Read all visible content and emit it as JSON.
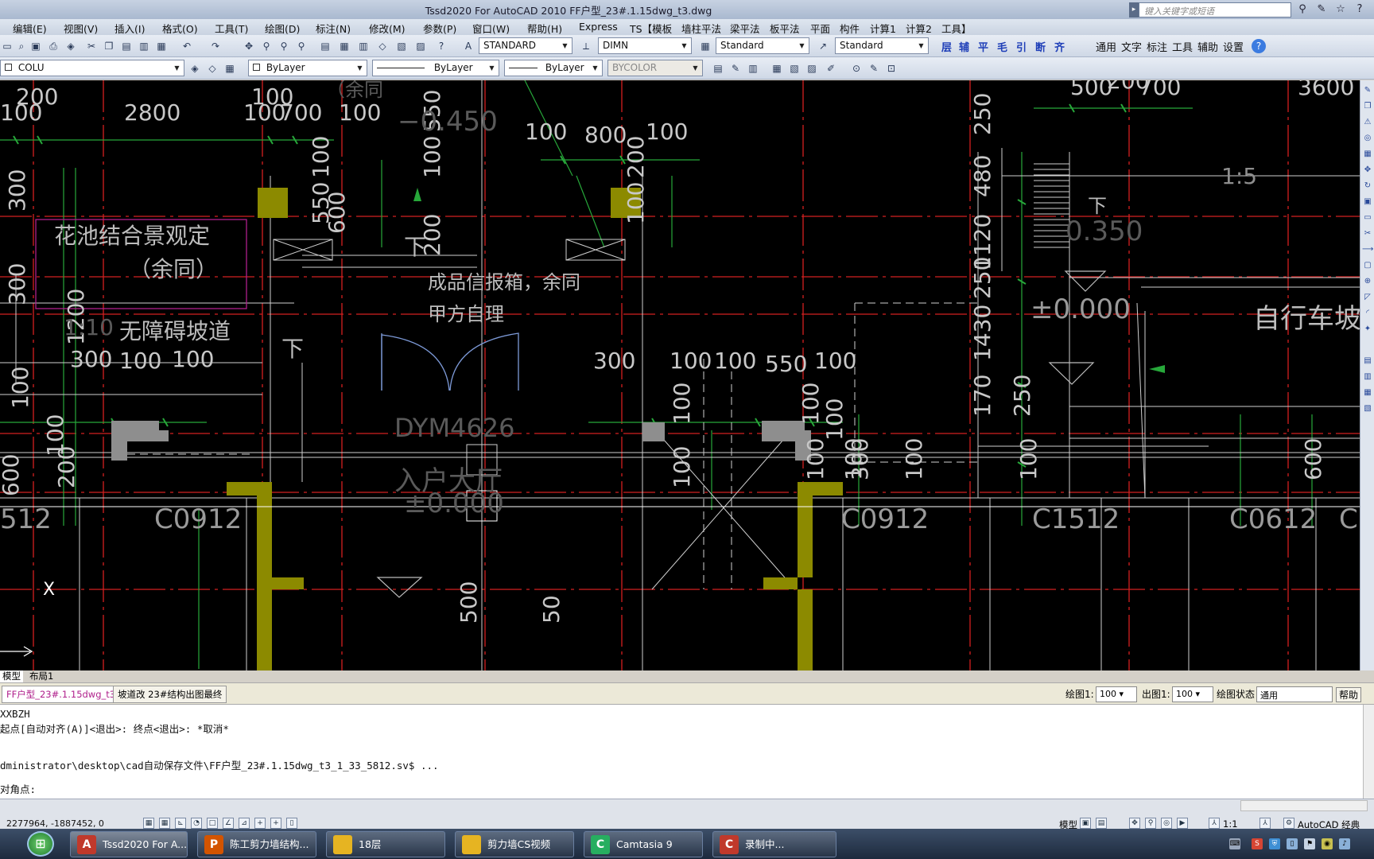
{
  "window": {
    "title": "Tssd2020 For AutoCAD 2010    FF户型_23#.1.15dwg_t3.dwg",
    "search_placeholder": "键入关键字或短语"
  },
  "menu": [
    "编辑(E)",
    "视图(V)",
    "插入(I)",
    "格式(O)",
    "工具(T)",
    "绘图(D)",
    "标注(N)",
    "修改(M)",
    "参数(P)",
    "窗口(W)",
    "帮助(H)",
    "Express",
    "TS【模板",
    "墙柱平法",
    "梁平法",
    "板平法",
    "平面",
    "构件",
    "计算1",
    "计算2",
    "工具】"
  ],
  "toolbar1": {
    "text_style": "STANDARD",
    "dim_style": "DIMN",
    "table_style": "Standard",
    "multileader_style": "Standard",
    "tssd_tools": [
      "层",
      "辅",
      "平",
      "毛",
      "引",
      "断",
      "齐"
    ],
    "tssd_menu": [
      "通用",
      "文字",
      "标注",
      "工具",
      "辅助",
      "设置"
    ]
  },
  "toolbar2": {
    "layer": "COLU",
    "color": "ByLayer",
    "linetype": "ByLayer",
    "lineweight": "ByLayer",
    "plotstyle": "BYCOLOR"
  },
  "drawing": {
    "dims": [
      "200",
      "100",
      "2800",
      "100",
      "100",
      "700",
      "100",
      "500",
      "200",
      "700",
      "3600",
      "100",
      "800",
      "100",
      "250",
      "480",
      "1120",
      "250",
      "1430",
      "170",
      "250",
      "300",
      "100",
      "100",
      "550",
      "100",
      "300",
      "100",
      "100",
      "550",
      "100",
      "100",
      "550",
      "100",
      "200",
      "600",
      "200",
      "100",
      "100",
      "600",
      "600",
      "300",
      "200",
      "100",
      "300",
      "1:5",
      "500",
      "50",
      "300",
      "1200",
      "100",
      "100",
      "100",
      "100",
      "100",
      "100",
      "100"
    ],
    "elev_neg": "−0.450",
    "elev_zero_a": "±0.000",
    "elev_zero_b": "±0.000",
    "elev_350": "0.350",
    "note_garden": "花池结合景观定",
    "note_same": "（余同）",
    "note_same_top": "（余同",
    "note_mailbox": "成品信报箱，余同",
    "note_owner": "甲方自理",
    "note_ramp": "无障碍坡道",
    "note_ramp_ratio": "1:10",
    "note_bike": "自行车坡",
    "down_a": "下",
    "down_b": "下",
    "down_c": "下",
    "door_tag": "DYM4626",
    "room_name": "入户大厅",
    "win_a": "512",
    "win_b": "C0912",
    "win_c": "C0912",
    "win_d": "C1512",
    "win_e": "C0612",
    "win_f": "C",
    "ucs_x": "X"
  },
  "tabs": {
    "model": "模型",
    "layout": "布局1"
  },
  "doctabs": [
    "FF户型_23#.1.15dwg_t3",
    "坡道改 23#结构出图最终"
  ],
  "docbar": {
    "draw_scale_label": "绘图1:",
    "draw_scale": "100",
    "plot_scale_label": "出图1:",
    "plot_scale": "100",
    "state_label": "绘图状态",
    "state": "通用",
    "help": "帮助"
  },
  "command": [
    "XXBZH",
    "起点[自动对齐(A)]<退出>:   终点<退出>: *取消*",
    "",
    "dministrator\\desktop\\cad自动保存文件\\FF户型_23#.1.15dwg_t3_1_33_5812.sv$ ...",
    "对角点:"
  ],
  "status": {
    "coords": "2277964, -1887452, 0",
    "model_label": "模型",
    "scale": "1:1",
    "workspace": "AutoCAD 经典"
  },
  "taskbar": [
    {
      "label": "Tssd2020 For A...",
      "icon": "autocad-icon",
      "color": "#c0392b"
    },
    {
      "label": "陈工剪力墙结构...",
      "icon": "powerpoint-icon",
      "color": "#d35400"
    },
    {
      "label": "18层",
      "icon": "folder-icon",
      "color": "#e6b422"
    },
    {
      "label": "剪力墙CS视频",
      "icon": "folder-icon",
      "color": "#e6b422"
    },
    {
      "label": "Camtasia 9",
      "icon": "camtasia-icon",
      "color": "#27ae60"
    },
    {
      "label": "录制中...",
      "icon": "recording-icon",
      "color": "#c0392b"
    }
  ]
}
